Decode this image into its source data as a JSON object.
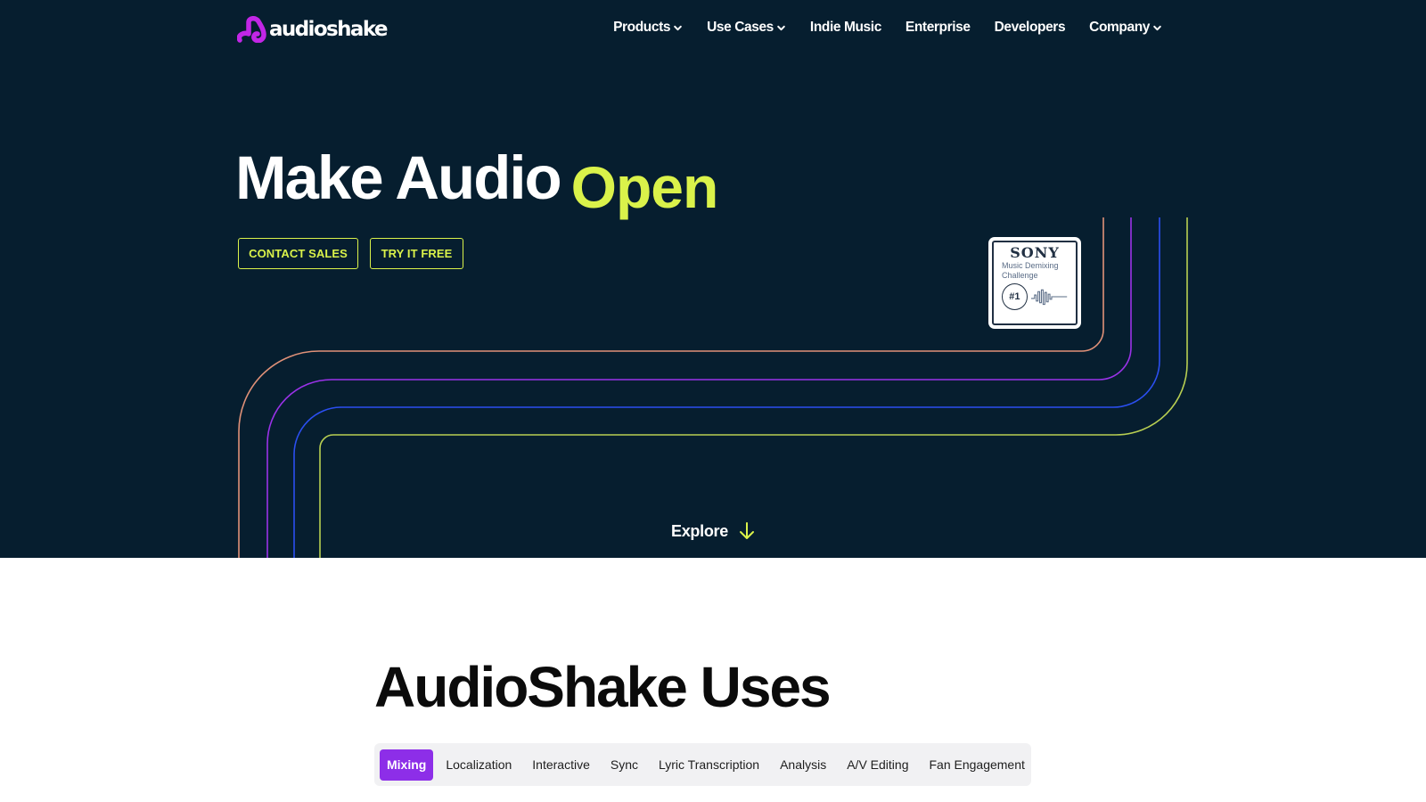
{
  "brand": {
    "logo_text": "audioshake",
    "logo_icon": "audioshake-logo-icon",
    "accent_color": "#daf24a",
    "logo_color": "#c226e6",
    "hero_bg": "#061e2f"
  },
  "nav": {
    "items": [
      {
        "label": "Products",
        "has_dropdown": true
      },
      {
        "label": "Use Cases",
        "has_dropdown": true
      },
      {
        "label": "Indie Music",
        "has_dropdown": false
      },
      {
        "label": "Enterprise",
        "has_dropdown": false
      },
      {
        "label": "Developers",
        "has_dropdown": false
      },
      {
        "label": "Company",
        "has_dropdown": true
      }
    ]
  },
  "hero": {
    "headline_main": "Make Audio",
    "headline_accent": "Open",
    "contact_label": "CONTACT SALES",
    "try_label": "TRY IT FREE",
    "explore_label": "Explore",
    "explore_icon": "arrow-down-icon",
    "line_colors": [
      "#e09178",
      "#9a32e8",
      "#2b4ff0",
      "#b8cf52"
    ]
  },
  "badge": {
    "brand": "SONY",
    "line1": "Music Demixing",
    "line2": "Challenge",
    "rank": "#1"
  },
  "uses": {
    "title": "AudioShake Uses",
    "active_tab_color": "#8d2ee8",
    "tabs": [
      {
        "label": "Mixing",
        "active": true
      },
      {
        "label": "Localization",
        "active": false
      },
      {
        "label": "Interactive",
        "active": false
      },
      {
        "label": "Sync",
        "active": false
      },
      {
        "label": "Lyric Transcription",
        "active": false
      },
      {
        "label": "Analysis",
        "active": false
      },
      {
        "label": "A/V Editing",
        "active": false
      },
      {
        "label": "Fan Engagement",
        "active": false
      }
    ]
  }
}
